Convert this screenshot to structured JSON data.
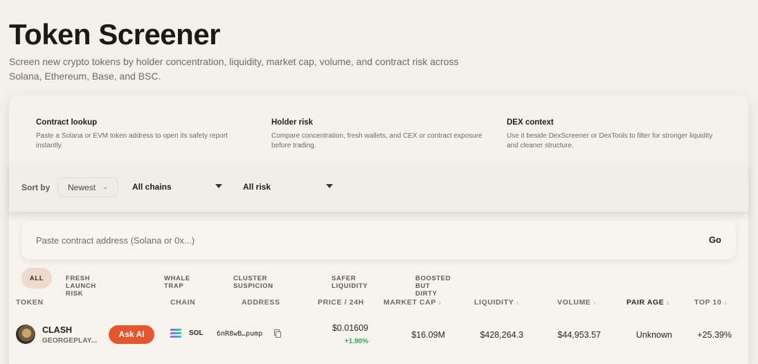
{
  "header": {
    "title": "Token Screener",
    "subtitle": "Screen new crypto tokens by holder concentration, liquidity, market cap, volume, and contract risk across Solana, Ethereum, Base, and BSC."
  },
  "info_cards": [
    {
      "title": "Contract lookup",
      "desc": "Paste a Solana or EVM token address to open its safety report instantly."
    },
    {
      "title": "Holder risk",
      "desc": "Compare concentration, fresh wallets, and CEX or contract exposure before trading."
    },
    {
      "title": "DEX context",
      "desc": "Use it beside DexScreener or DexTools to filter for stronger liquidity and cleaner structure."
    }
  ],
  "filters": {
    "sort_label": "Sort by",
    "sort_value": "Newest",
    "chain_value": "All chains",
    "risk_value": "All risk"
  },
  "search": {
    "placeholder": "Paste contract address (Solana or 0x...)",
    "go_label": "Go"
  },
  "chips": [
    "ALL",
    "FRESH LAUNCH RISK",
    "WHALE TRAP",
    "CLUSTER SUSPICION",
    "SAFER LIQUIDITY",
    "BOOSTED BUT DIRTY"
  ],
  "table": {
    "headers": {
      "token": "TOKEN",
      "chain": "CHAIN",
      "address": "ADDRESS",
      "price": "PRICE / 24H",
      "market_cap": "MARKET CAP",
      "liquidity": "LIQUIDITY",
      "volume": "VOLUME",
      "pair_age": "PAIR AGE",
      "top10": "TOP 10"
    },
    "rows": [
      {
        "symbol": "CLASH",
        "name": "GEORGEPLAY...",
        "ask_ai": "Ask AI",
        "chain": "SOL",
        "address": "6nR8wB…pump",
        "price": "$0.01609",
        "change": "+1.90%",
        "market_cap": "$16.09M",
        "liquidity": "$428,264.3",
        "volume": "$44,953.57",
        "pair_age": "Unknown",
        "top10": "+25.39%"
      }
    ]
  },
  "colors": {
    "accent": "#e5562c",
    "positive": "#2faa5a",
    "background": "#f3f0ea"
  }
}
